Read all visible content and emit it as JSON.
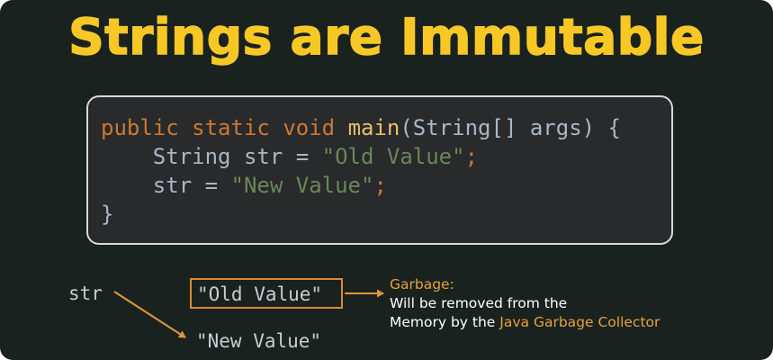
{
  "title": "Strings are Immutable",
  "code": {
    "line1": {
      "kw1": "public",
      "kw2": "static",
      "kw3": "void",
      "fn": "main",
      "rest": "(String[] args) {"
    },
    "line2": {
      "decl": "String str = ",
      "str": "\"Old Value\"",
      "semi": ";"
    },
    "line3": {
      "decl": "str = ",
      "str": "\"New Value\"",
      "semi": ";"
    },
    "line4": "}"
  },
  "diagram": {
    "var_label": "str",
    "old_value": "\"Old Value\"",
    "new_value": "\"New Value\"",
    "note_heading": "Garbage:",
    "note_line1": "Will be removed from the",
    "note_line2_prefix": "Memory by the ",
    "note_line2_highlight": "Java Garbage Collector"
  },
  "colors": {
    "background": "#1a2220",
    "title": "#f7c825",
    "keyword": "#cc7832",
    "string": "#6a8759",
    "arrow": "#e0963a"
  }
}
